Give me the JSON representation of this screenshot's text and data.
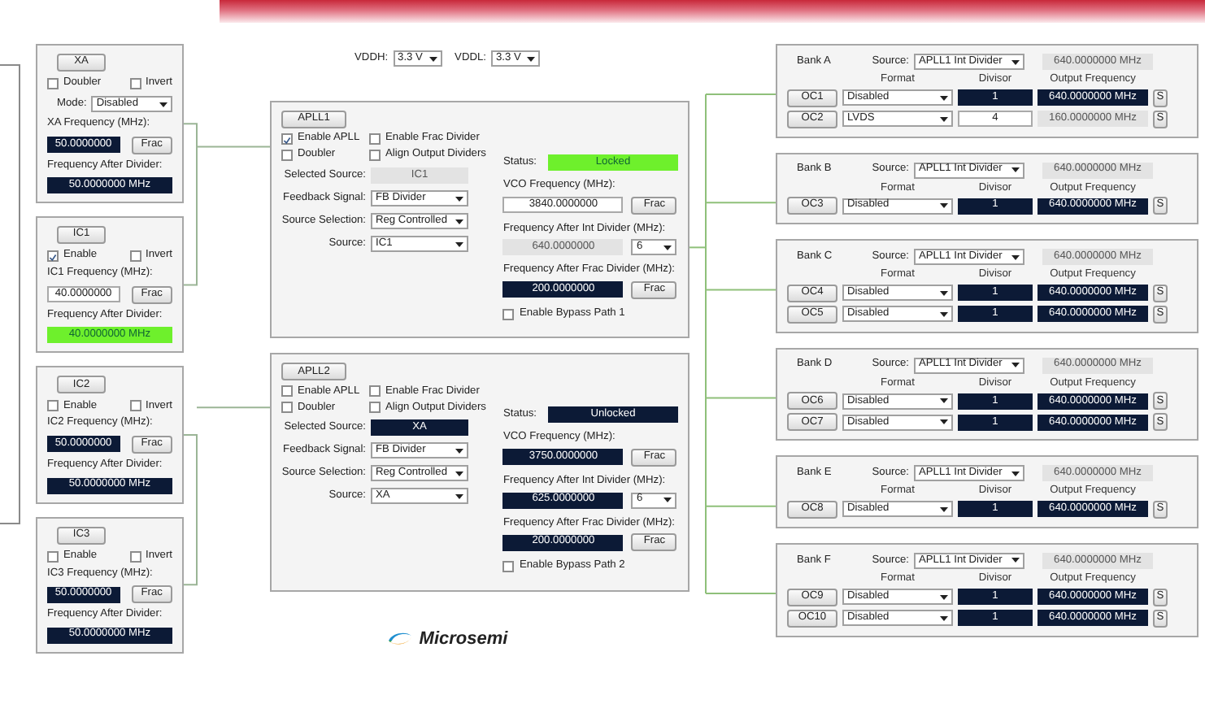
{
  "inputs": [
    {
      "kind": "crystal",
      "title": "XA",
      "options": [
        {
          "label": "Doubler",
          "checked": false
        },
        {
          "label": "Invert",
          "checked": false
        }
      ],
      "mode_label": "Mode:",
      "mode": "Disabled",
      "freq_label": "XA Frequency (MHz):",
      "freq": {
        "value": "50.0000000",
        "kind": "readout"
      },
      "button": "Frac",
      "after_label": "Frequency After Divider:",
      "after": {
        "value": "50.0000000 MHz",
        "kind": "readout"
      }
    },
    {
      "kind": "clock",
      "title": "IC1",
      "options": [
        {
          "label": "Enable",
          "checked": true
        },
        {
          "label": "Invert",
          "checked": false
        }
      ],
      "freq_label": "IC1 Frequency (MHz):",
      "freq": {
        "value": "40.0000000",
        "kind": "entry"
      },
      "button": "Frac",
      "after_label": "Frequency After Divider:",
      "after": {
        "value": "40.0000000 MHz",
        "kind": "highlight"
      }
    },
    {
      "kind": "clock",
      "title": "IC2",
      "options": [
        {
          "label": "Enable",
          "checked": false
        },
        {
          "label": "Invert",
          "checked": false
        }
      ],
      "freq_label": "IC2 Frequency (MHz):",
      "freq": {
        "value": "50.0000000",
        "kind": "readout"
      },
      "button": "Frac",
      "after_label": "Frequency After Divider:",
      "after": {
        "value": "50.0000000 MHz",
        "kind": "readout"
      }
    },
    {
      "kind": "clock",
      "title": "IC3",
      "options": [
        {
          "label": "Enable",
          "checked": false
        },
        {
          "label": "Invert",
          "checked": false
        }
      ],
      "freq_label": "IC3 Frequency (MHz):",
      "freq": {
        "value": "50.0000000",
        "kind": "readout"
      },
      "button": "Frac",
      "after_label": "Frequency After Divider:",
      "after": {
        "value": "50.0000000 MHz",
        "kind": "readout"
      }
    }
  ],
  "supplies": [
    {
      "label": "VDDH:",
      "value": "3.3 V"
    },
    {
      "label": "VDDL:",
      "value": "3.3 V"
    }
  ],
  "aplls": [
    {
      "title": "APLL1",
      "options": [
        {
          "label": "Enable APLL",
          "checked": true
        },
        {
          "label": "Enable Frac Divider",
          "checked": false
        },
        {
          "label": "Doubler",
          "checked": false
        },
        {
          "label": "Align Output Dividers",
          "checked": false
        }
      ],
      "status_label": "Status:",
      "status": {
        "value": "Locked",
        "kind": "highlight"
      },
      "fields": [
        {
          "label": "Selected Source:",
          "kind": "display",
          "display": {
            "value": "IC1",
            "kind": "inactive"
          }
        },
        {
          "label": "Feedback Signal:",
          "kind": "select",
          "value": "FB Divider"
        },
        {
          "label": "Source Selection:",
          "kind": "select",
          "value": "Reg Controlled"
        },
        {
          "label": "Source:",
          "kind": "select",
          "value": "IC1"
        }
      ],
      "vco_label": "VCO Frequency (MHz):",
      "vco": {
        "value": "3840.0000000",
        "kind": "entry"
      },
      "vco_button": "Frac",
      "int_label": "Frequency After Int Divider (MHz):",
      "int": {
        "value": "640.0000000",
        "kind": "inactive"
      },
      "int_divider": "6",
      "frac_label": "Frequency After Frac Divider (MHz):",
      "frac": {
        "value": "200.0000000",
        "kind": "readout"
      },
      "frac_button": "Frac",
      "bypass": {
        "label": "Enable Bypass Path 1",
        "checked": false
      }
    },
    {
      "title": "APLL2",
      "options": [
        {
          "label": "Enable APLL",
          "checked": false
        },
        {
          "label": "Enable Frac Divider",
          "checked": false
        },
        {
          "label": "Doubler",
          "checked": false
        },
        {
          "label": "Align Output Dividers",
          "checked": false
        }
      ],
      "status_label": "Status:",
      "status": {
        "value": "Unlocked",
        "kind": "readout"
      },
      "fields": [
        {
          "label": "Selected Source:",
          "kind": "display",
          "display": {
            "value": "XA",
            "kind": "readout"
          }
        },
        {
          "label": "Feedback Signal:",
          "kind": "select",
          "value": "FB Divider"
        },
        {
          "label": "Source Selection:",
          "kind": "select",
          "value": "Reg Controlled"
        },
        {
          "label": "Source:",
          "kind": "select",
          "value": "XA"
        }
      ],
      "vco_label": "VCO Frequency (MHz):",
      "vco": {
        "value": "3750.0000000",
        "kind": "readout"
      },
      "vco_button": "Frac",
      "int_label": "Frequency After Int Divider (MHz):",
      "int": {
        "value": "625.0000000",
        "kind": "readout"
      },
      "int_divider": "6",
      "frac_label": "Frequency After Frac Divider (MHz):",
      "frac": {
        "value": "200.0000000",
        "kind": "readout"
      },
      "frac_button": "Frac",
      "bypass": {
        "label": "Enable Bypass Path 2",
        "checked": false
      }
    }
  ],
  "logo": {
    "text": "Microsemi"
  },
  "banks": [
    {
      "title": "Bank A",
      "source_label": "Source:",
      "source": "APLL1 Int Divider",
      "source_freq": "640.0000000 MHz",
      "headers": [
        "Format",
        "Divisor",
        "Output Frequency"
      ],
      "outputs": [
        {
          "name": "OC1",
          "format": "Disabled",
          "divisor": {
            "value": "1",
            "kind": "readout"
          },
          "frequency": {
            "value": "640.0000000 MHz",
            "kind": "readout"
          },
          "button": "S"
        },
        {
          "name": "OC2",
          "format": "LVDS",
          "divisor": {
            "value": "4",
            "kind": "entry"
          },
          "frequency": {
            "value": "160.0000000 MHz",
            "kind": "inactive"
          },
          "button": "S"
        }
      ]
    },
    {
      "title": "Bank B",
      "source_label": "Source:",
      "source": "APLL1 Int Divider",
      "source_freq": "640.0000000 MHz",
      "headers": [
        "Format",
        "Divisor",
        "Output Frequency"
      ],
      "outputs": [
        {
          "name": "OC3",
          "format": "Disabled",
          "divisor": {
            "value": "1",
            "kind": "readout"
          },
          "frequency": {
            "value": "640.0000000 MHz",
            "kind": "readout"
          },
          "button": "S"
        }
      ]
    },
    {
      "title": "Bank C",
      "source_label": "Source:",
      "source": "APLL1 Int Divider",
      "source_freq": "640.0000000 MHz",
      "headers": [
        "Format",
        "Divisor",
        "Output Frequency"
      ],
      "outputs": [
        {
          "name": "OC4",
          "format": "Disabled",
          "divisor": {
            "value": "1",
            "kind": "readout"
          },
          "frequency": {
            "value": "640.0000000 MHz",
            "kind": "readout"
          },
          "button": "S"
        },
        {
          "name": "OC5",
          "format": "Disabled",
          "divisor": {
            "value": "1",
            "kind": "readout"
          },
          "frequency": {
            "value": "640.0000000 MHz",
            "kind": "readout"
          },
          "button": "S"
        }
      ]
    },
    {
      "title": "Bank D",
      "source_label": "Source:",
      "source": "APLL1 Int Divider",
      "source_freq": "640.0000000 MHz",
      "headers": [
        "Format",
        "Divisor",
        "Output Frequency"
      ],
      "outputs": [
        {
          "name": "OC6",
          "format": "Disabled",
          "divisor": {
            "value": "1",
            "kind": "readout"
          },
          "frequency": {
            "value": "640.0000000 MHz",
            "kind": "readout"
          },
          "button": "S"
        },
        {
          "name": "OC7",
          "format": "Disabled",
          "divisor": {
            "value": "1",
            "kind": "readout"
          },
          "frequency": {
            "value": "640.0000000 MHz",
            "kind": "readout"
          },
          "button": "S"
        }
      ]
    },
    {
      "title": "Bank E",
      "source_label": "Source:",
      "source": "APLL1 Int Divider",
      "source_freq": "640.0000000 MHz",
      "headers": [
        "Format",
        "Divisor",
        "Output Frequency"
      ],
      "outputs": [
        {
          "name": "OC8",
          "format": "Disabled",
          "divisor": {
            "value": "1",
            "kind": "readout"
          },
          "frequency": {
            "value": "640.0000000 MHz",
            "kind": "readout"
          },
          "button": "S"
        }
      ]
    },
    {
      "title": "Bank F",
      "source_label": "Source:",
      "source": "APLL1 Int Divider",
      "source_freq": "640.0000000 MHz",
      "headers": [
        "Format",
        "Divisor",
        "Output Frequency"
      ],
      "outputs": [
        {
          "name": "OC9",
          "format": "Disabled",
          "divisor": {
            "value": "1",
            "kind": "readout"
          },
          "frequency": {
            "value": "640.0000000 MHz",
            "kind": "readout"
          },
          "button": "S"
        },
        {
          "name": "OC10",
          "format": "Disabled",
          "divisor": {
            "value": "1",
            "kind": "readout"
          },
          "frequency": {
            "value": "640.0000000 MHz",
            "kind": "readout"
          },
          "button": "S"
        }
      ]
    }
  ]
}
